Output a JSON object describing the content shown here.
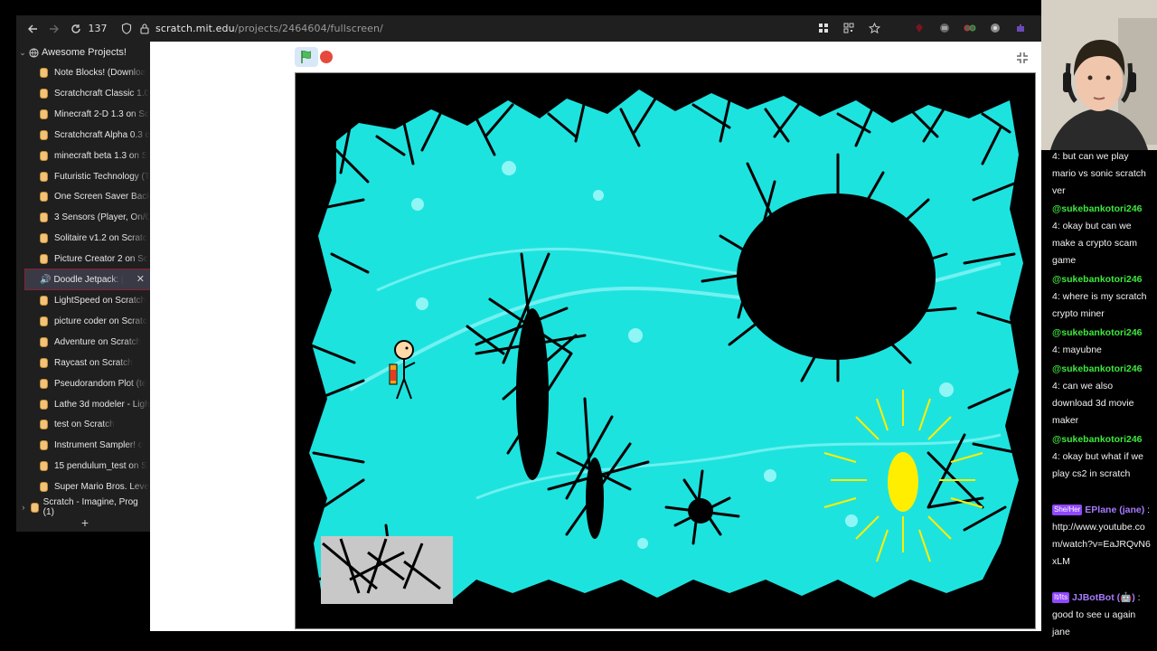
{
  "browser": {
    "tab_counter": "137",
    "url_host": "scratch.mit.edu",
    "url_path": "/projects/2464604/fullscreen/"
  },
  "sidebar": {
    "group_label": "Awesome Projects!",
    "tabs": [
      {
        "label": "Note Blocks! (Downloa"
      },
      {
        "label": "Scratchcraft Classic 1.0"
      },
      {
        "label": "Minecraft 2-D 1.3 on Sc"
      },
      {
        "label": "Scratchcraft Alpha 0.3 o"
      },
      {
        "label": "minecraft beta 1.3 on S"
      },
      {
        "label": "Futuristic Technology (T"
      },
      {
        "label": "One Screen Saver Back"
      },
      {
        "label": "3 Sensors (Player, On/O"
      },
      {
        "label": "Solitaire v1.2 on Scratc"
      },
      {
        "label": "Picture Creator 2 on Sc"
      },
      {
        "label": "Doodle Jetpack: |"
      },
      {
        "label": "LightSpeed on Scratch"
      },
      {
        "label": "picture coder on Scratc"
      },
      {
        "label": "Adventure on Scratch"
      },
      {
        "label": "Raycast on Scratch"
      },
      {
        "label": "Pseudorandom Plot (te"
      },
      {
        "label": "Lathe 3d modeler - Ligh"
      },
      {
        "label": "test on Scratch"
      },
      {
        "label": "Instrument Sampler! o"
      },
      {
        "label": "15 pendulum_test on S"
      },
      {
        "label": "Super Mario Bros. Leve"
      }
    ],
    "bottom_item": "Scratch - Imagine, Prog (1)",
    "new_tab": "+"
  },
  "chat": {
    "messages": [
      {
        "user": "",
        "text": "4: but can we play mario vs sonic scratch ver"
      },
      {
        "user": "@sukebankotori246",
        "text": "4: okay but can we make a crypto scam game"
      },
      {
        "user": "@sukebankotori246",
        "text": "4: where is my scratch crypto miner"
      },
      {
        "user": "@sukebankotori246",
        "text": "4: mayubne"
      },
      {
        "user": "@sukebankotori246",
        "text": "4: can we also download 3d movie maker"
      },
      {
        "user": "@sukebankotori246",
        "text": "4: okay but what if we play cs2 in scratch"
      },
      {
        "badge": "She/Her",
        "user": "EPlane (jane)",
        "text": ": http://www.youtube.com/watch?v=EaJRQvN6xLM"
      },
      {
        "badge": "It/Its",
        "user": "JJBotBot (🤖)",
        "text": ": good to see u again jane"
      }
    ]
  },
  "colors": {
    "stage_cyan": "#1de3df",
    "sun_yellow": "#ffee00",
    "stop_red": "#e64a3c",
    "flag_green": "#4cbf56",
    "chat_user_green": "#3ee83e",
    "chat_user_purple": "#a77bff"
  }
}
